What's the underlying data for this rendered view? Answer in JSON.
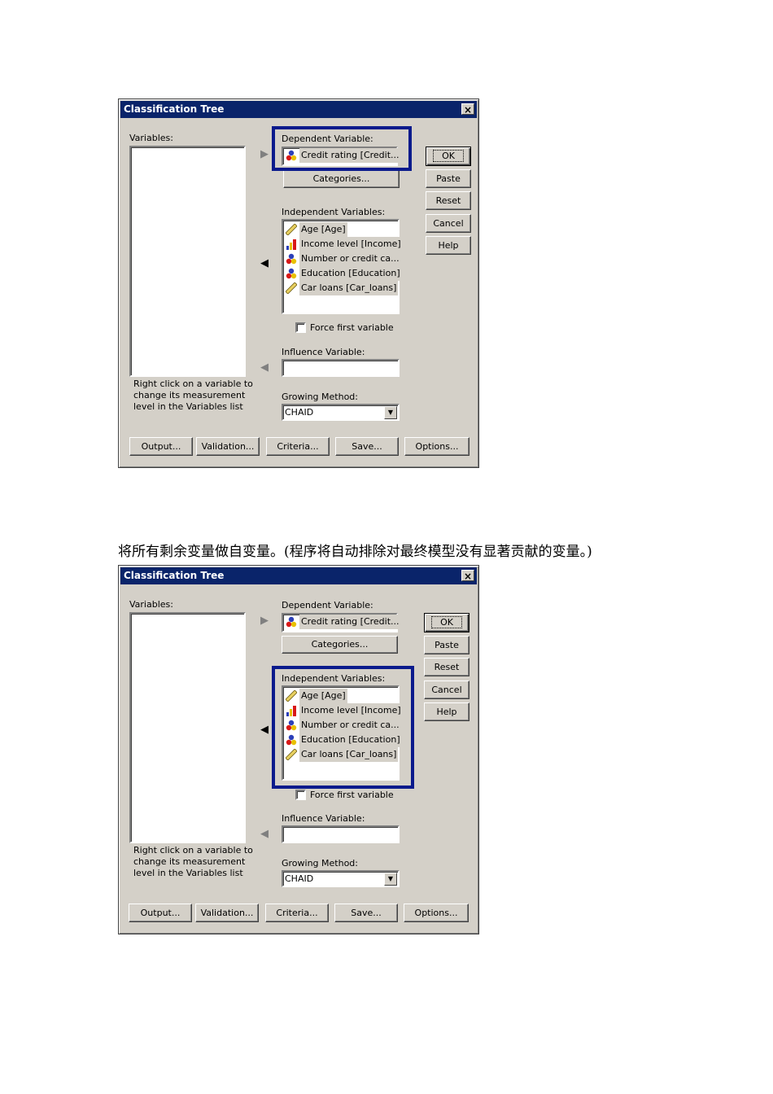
{
  "caption": "将所有剩余变量做自变量。(程序将自动排除对最终模型没有显著贡献的变量。)",
  "dialog": {
    "title": "Classification Tree",
    "close": "×",
    "variables_label": "Variables:",
    "dependent_label": "Dependent Variable:",
    "dependent_value": "Credit rating [Credit...",
    "categories_button": "Categories...",
    "independent_label": "Independent Variables:",
    "independent_items": [
      {
        "label": "Age [Age]",
        "icon": "scale-ruler-icon"
      },
      {
        "label": "Income level [Income]",
        "icon": "ordinal-bars-icon"
      },
      {
        "label": "Number or credit ca...",
        "icon": "nominal-balls-icon"
      },
      {
        "label": "Education [Education]",
        "icon": "nominal-balls-icon"
      },
      {
        "label": "Car loans [Car_loans]",
        "icon": "scale-ruler-icon"
      }
    ],
    "force_first_label": "Force first variable",
    "influence_label": "Influence Variable:",
    "help_text_lines": [
      "Right click on a variable to",
      "change its measurement",
      "level in the Variables list"
    ],
    "growing_label": "Growing Method:",
    "growing_value": "CHAID",
    "side_buttons": [
      "OK",
      "Paste",
      "Reset",
      "Cancel",
      "Help"
    ],
    "bottom_buttons": [
      "Output...",
      "Validation...",
      "Criteria...",
      "Save...",
      "Options..."
    ]
  },
  "colors": {
    "title_bar": "#0a246a",
    "highlight_box": "#0a1a8c",
    "dialog_face": "#d4d0c8"
  }
}
